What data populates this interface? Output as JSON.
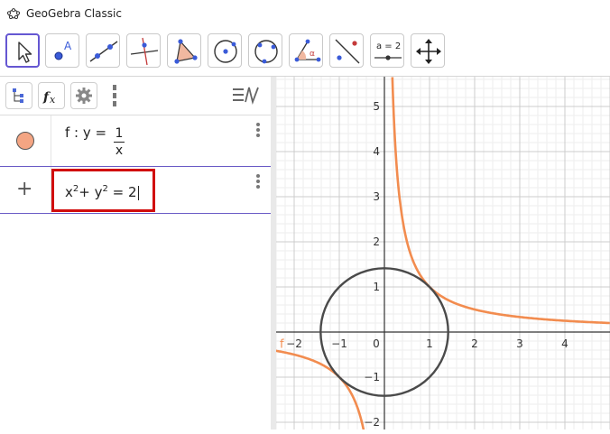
{
  "window": {
    "title": "GeoGebra Classic"
  },
  "toolbar": {
    "tools": [
      {
        "name": "move-tool",
        "label": ""
      },
      {
        "name": "point-tool",
        "label": "A"
      },
      {
        "name": "line-tool",
        "label": ""
      },
      {
        "name": "perpendicular-tool",
        "label": ""
      },
      {
        "name": "polygon-tool",
        "label": ""
      },
      {
        "name": "circle-center-point-tool",
        "label": ""
      },
      {
        "name": "circle-three-points-tool",
        "label": ""
      },
      {
        "name": "angle-tool",
        "label": "α"
      },
      {
        "name": "reflect-tool",
        "label": ""
      },
      {
        "name": "slider-tool",
        "label": "a = 2"
      },
      {
        "name": "move-graphics-tool",
        "label": ""
      }
    ]
  },
  "algebra": {
    "rows": [
      {
        "label": "f",
        "expr": "y =",
        "numerator": "1",
        "denominator": "x",
        "color": "#f4a583"
      },
      {
        "input_parts": [
          "x",
          "2",
          "+ y",
          "2",
          " = 2"
        ]
      }
    ]
  },
  "graphics": {
    "x_ticks": [
      "−2",
      "−1",
      "0",
      "1",
      "2",
      "3",
      "4"
    ],
    "y_ticks": [
      "5",
      "4",
      "3",
      "2",
      "1",
      "−1",
      "−2"
    ],
    "function_label": "f",
    "curve_color": "#f28c4f",
    "circle_color": "#4a4a4a"
  }
}
